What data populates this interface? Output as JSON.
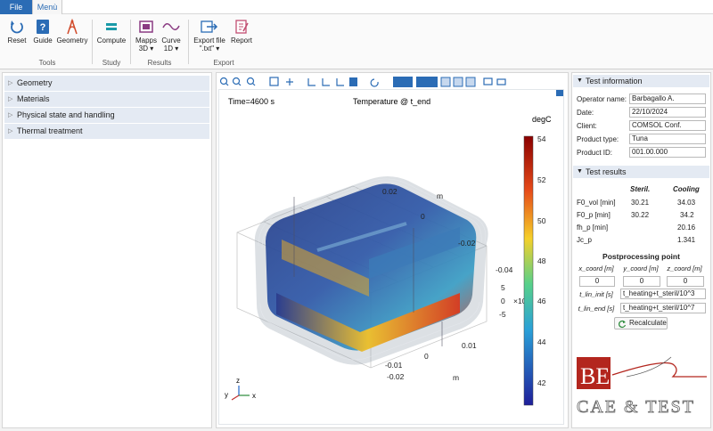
{
  "menubar": {
    "file": "File",
    "menu": "Menù"
  },
  "ribbon": {
    "buttons": {
      "reset": "Reset",
      "guide": "Guide",
      "geometry": "Geometry",
      "compute": "Compute",
      "mapps3d": "Mapps\n3D ▾",
      "mapps_l1": "Mapps",
      "mapps_l2": "3D ▾",
      "curve_l1": "Curve",
      "curve_l2": "1D ▾",
      "export_l1": "Export file",
      "export_l2": "\".txt\" ▾",
      "report": "Report"
    },
    "groups": {
      "tools": "Tools",
      "study": "Study",
      "results": "Results",
      "export": "Export"
    }
  },
  "left_tree": [
    "Geometry",
    "Materials",
    "Physical state and handling",
    "Thermal treatment"
  ],
  "plot": {
    "time_label": "Time=4600 s",
    "title": "Temperature @ t_end",
    "unit": "degC",
    "colorbar_ticks": [
      "54",
      "52",
      "50",
      "48",
      "46",
      "44",
      "42"
    ],
    "axis_labels": {
      "y_top": "0.02",
      "y_zero": "0",
      "y_neg": "-0.02",
      "y_m": "m",
      "z_neg004": "-0.04",
      "z_5": "5",
      "z_0": "0",
      "z_neg5": "-5",
      "z_exp": "×10⁻³",
      "x_001": "0.01",
      "x_0": "0",
      "x_neg001": "-0.01",
      "x_neg002": "-0.02",
      "x_m": "m"
    },
    "triad": {
      "x": "x",
      "y": "y",
      "z": "z"
    },
    "colors": {
      "max": "#9e0000",
      "mid": "#47c8a0",
      "min": "#1f1f9a"
    }
  },
  "test_information": {
    "header": "Test information",
    "fields": [
      {
        "label": "Operator name:",
        "value": "Barbagallo A."
      },
      {
        "label": "Date:",
        "value": "22/10/2024"
      },
      {
        "label": "Client:",
        "value": "COMSOL Conf."
      },
      {
        "label": "Product type:",
        "value": "Tuna"
      },
      {
        "label": "Product ID:",
        "value": "001.00.000"
      }
    ]
  },
  "test_results": {
    "header": "Test results",
    "columns": [
      "Steril.",
      "Cooling"
    ],
    "rows": [
      {
        "label": "F0_vol [min]",
        "steril": "30.21",
        "cooling": "34.03"
      },
      {
        "label": "F0_p [min]",
        "steril": "30.22",
        "cooling": "34.2"
      },
      {
        "label": "fh_p [min]",
        "steril": "",
        "cooling": "20.16"
      },
      {
        "label": "Jc_p",
        "steril": "",
        "cooling": "1.341"
      }
    ]
  },
  "postprocessing": {
    "title": "Postprocessing point",
    "coord_headers": [
      "x_coord [m]",
      "y_coord [m]",
      "z_coord [m]"
    ],
    "coord_values": [
      "0",
      "0",
      "0"
    ],
    "t_lin_init_label": "t_lin_init [s]",
    "t_lin_init_value": "t_heating+t_steril/10^3",
    "t_lin_end_label": "t_lin_end [s]",
    "t_lin_end_value": "t_heating+t_steril/10^7",
    "recalculate": "Recalculate"
  },
  "logo": {
    "text": "CAE & TEST",
    "mark": "BE"
  }
}
